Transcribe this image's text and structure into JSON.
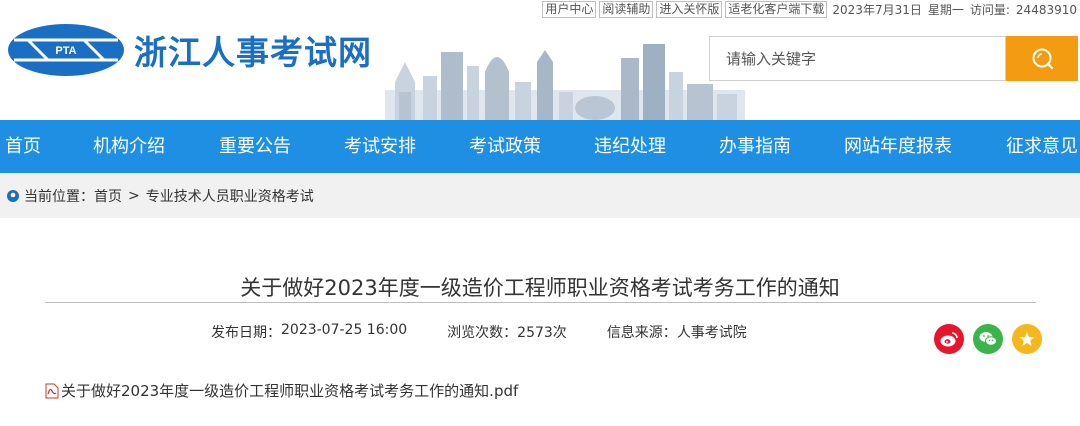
{
  "topbar": {
    "links": [
      "用户中心",
      "阅读辅助",
      "进入关怀版",
      "适老化客户端下载"
    ],
    "date": "2023年7月31日",
    "weekday": "星期一",
    "visits_label": "访问量:",
    "visits_value": "24483910"
  },
  "header": {
    "logo_emblem_text": "PTA",
    "site_name": "浙江人事考试网",
    "search_placeholder": "请输入关键字"
  },
  "nav": {
    "items": [
      "首页",
      "机构介绍",
      "重要公告",
      "考试安排",
      "考试政策",
      "违纪处理",
      "办事指南",
      "网站年度报表",
      "征求意见"
    ]
  },
  "breadcrumb": {
    "label": "当前位置：",
    "home": "首页",
    "separator": ">",
    "current": "专业技术人员职业资格考试"
  },
  "article": {
    "title": "关于做好2023年度一级造价工程师职业资格考试考务工作的通知",
    "publish_label": "发布日期：",
    "publish_date": "2023-07-25 16:00",
    "views_label": "浏览次数：",
    "views_value": "2573次",
    "source_label": "信息来源：",
    "source_value": "人事考试院",
    "attachment": "关于做好2023年度一级造价工程师职业资格考试考务工作的通知.pdf"
  },
  "share": [
    "weibo-icon",
    "wechat-icon",
    "favorite-icon"
  ],
  "colors": {
    "nav_bg": "#1f8fe3",
    "brand_blue": "#1a6fc4",
    "search_button": "#f39c12",
    "weibo": "#e6162d",
    "wechat": "#3bb44a",
    "favorite": "#f5b81c"
  }
}
